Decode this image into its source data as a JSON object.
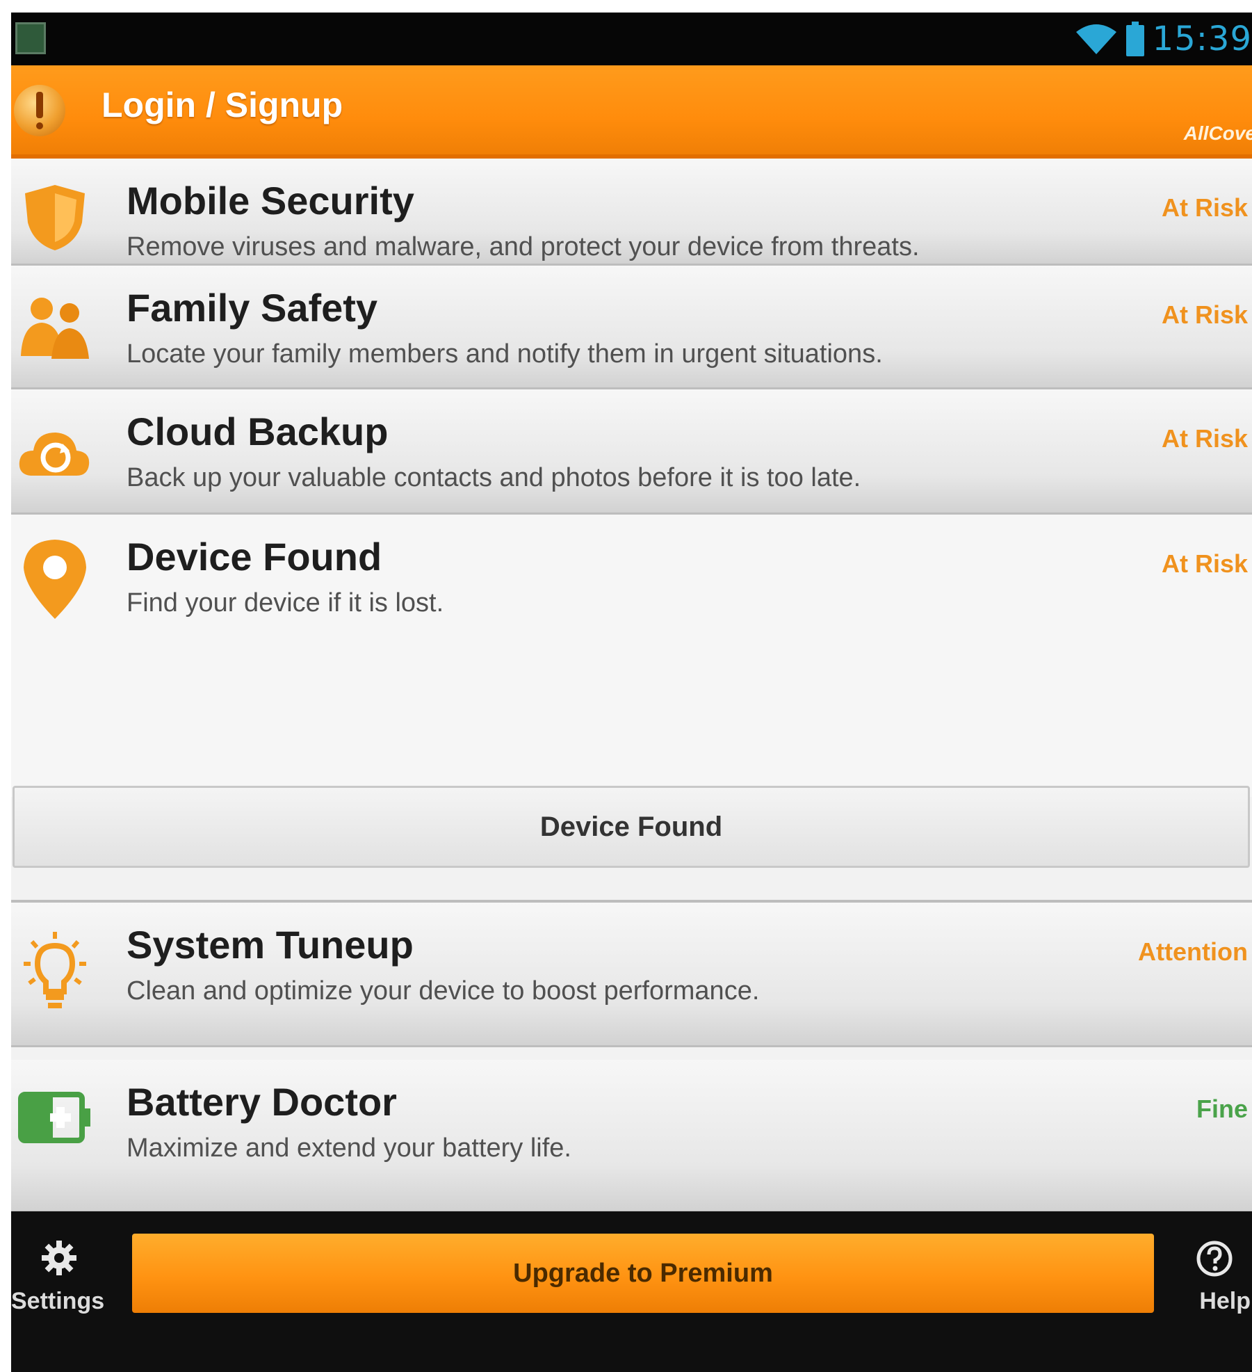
{
  "status_bar": {
    "clock": "15:39",
    "icons": [
      "app-notification-icon",
      "wifi-icon",
      "battery-icon"
    ],
    "clock_color": "#2aa7d6"
  },
  "action_bar": {
    "title": "Login / Signup",
    "brand": "AllCove",
    "accent": "#ff8c0c",
    "icon": "alert-icon"
  },
  "features": [
    {
      "title": "Mobile Security",
      "description": "Remove viruses and malware, and protect your device from threats.",
      "status": "At Risk",
      "status_color": "#f0921e",
      "icon": "shield-icon"
    },
    {
      "title": "Family Safety",
      "description": "Locate your family members and notify them in urgent situations.",
      "status": "At Risk",
      "status_color": "#f0921e",
      "icon": "family-icon"
    },
    {
      "title": "Cloud Backup",
      "description": "Back up your valuable contacts and photos before it is too late.",
      "status": "At Risk",
      "status_color": "#f0921e",
      "icon": "cloud-sync-icon"
    },
    {
      "title": "Device Found",
      "description": "Find your device if it is lost.",
      "status": "At Risk",
      "status_color": "#f0921e",
      "icon": "location-pin-icon"
    },
    {
      "title": "System Tuneup",
      "description": "Clean and optimize your device to boost performance.",
      "status": "Attention",
      "status_color": "#f0921e",
      "icon": "lightbulb-icon"
    },
    {
      "title": "Battery Doctor",
      "description": "Maximize and extend your battery life.",
      "status": "Fine",
      "status_color": "#4aa34a",
      "icon": "battery-plus-icon"
    }
  ],
  "device_found_button": "Device Found",
  "bottom_bar": {
    "settings_label": "Settings",
    "upgrade_label": "Upgrade to Premium",
    "help_label": "Help",
    "settings_icon": "gear-icon",
    "help_icon": "help-icon"
  }
}
